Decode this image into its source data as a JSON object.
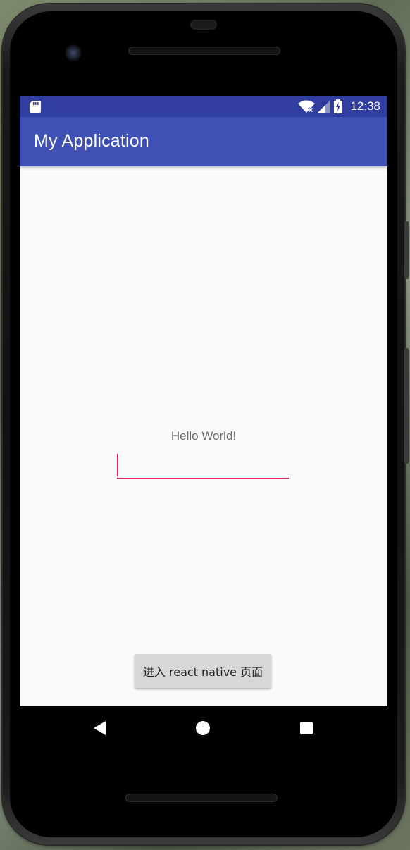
{
  "status_bar": {
    "time": "12:38",
    "icons": [
      "sd-card-icon",
      "wifi-icon",
      "signal-icon",
      "battery-charging-icon"
    ]
  },
  "app_bar": {
    "title": "My Application"
  },
  "main": {
    "greeting": "Hello World!",
    "text_field_value": "",
    "button_label": "进入 react native 页面"
  },
  "nav_bar": {
    "buttons": [
      "back-icon",
      "home-icon",
      "recents-icon"
    ]
  },
  "colors": {
    "status_bar": "#303f9f",
    "app_bar": "#3f51b5",
    "accent": "#e91e63",
    "background": "#fafafa"
  }
}
